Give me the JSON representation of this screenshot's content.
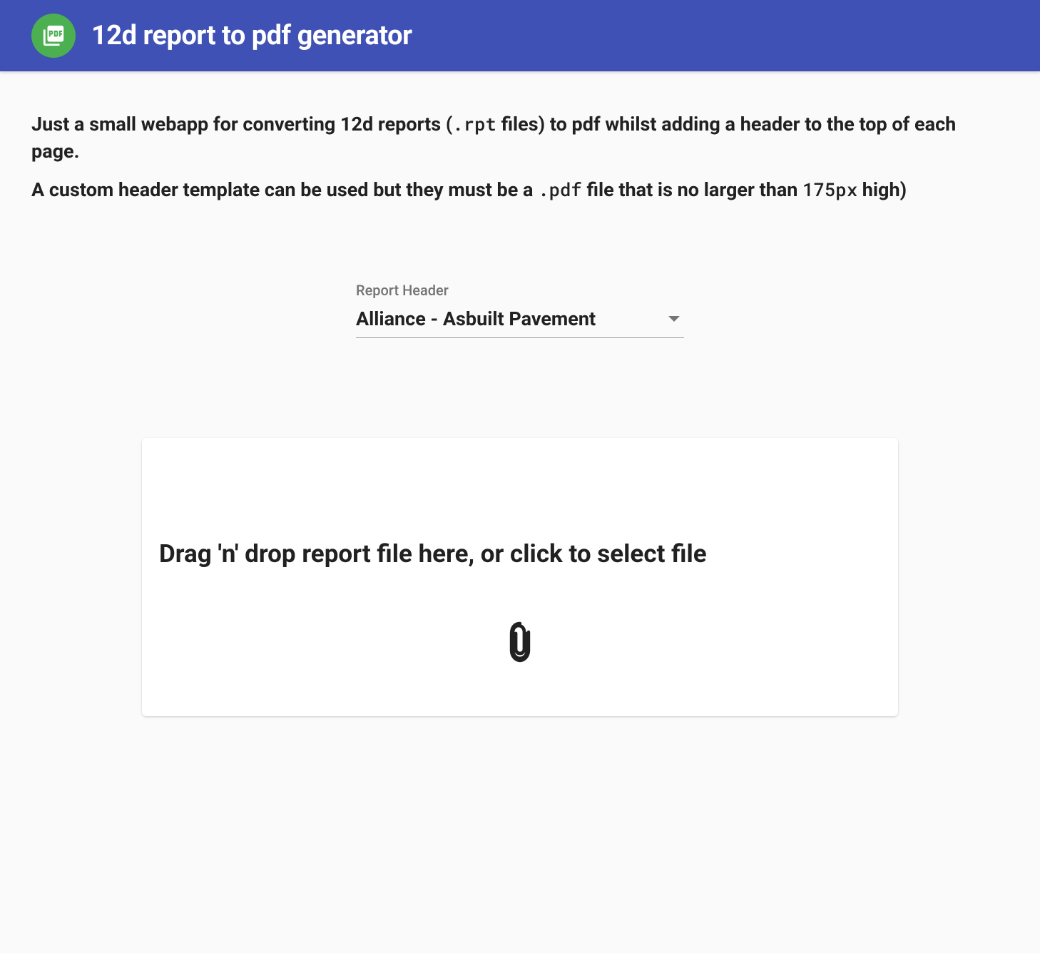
{
  "header": {
    "title": "12d report to pdf generator",
    "logo_icon": "pdf-icon"
  },
  "intro": {
    "p1_prefix": "Just a small webapp for converting 12d reports (",
    "p1_code": ".rpt",
    "p1_suffix": " files) to pdf whilst adding a header to the top of each page.",
    "p2_prefix": "A custom header template can be used but they must be a ",
    "p2_code1": ".pdf",
    "p2_mid": " file that is no larger than ",
    "p2_code2": "175px",
    "p2_suffix": " high)"
  },
  "form": {
    "header_select": {
      "label": "Report Header",
      "value": "Alliance - Asbuilt Pavement"
    }
  },
  "dropzone": {
    "text": "Drag 'n' drop report file here, or click to select file",
    "icon": "attachment-icon"
  }
}
